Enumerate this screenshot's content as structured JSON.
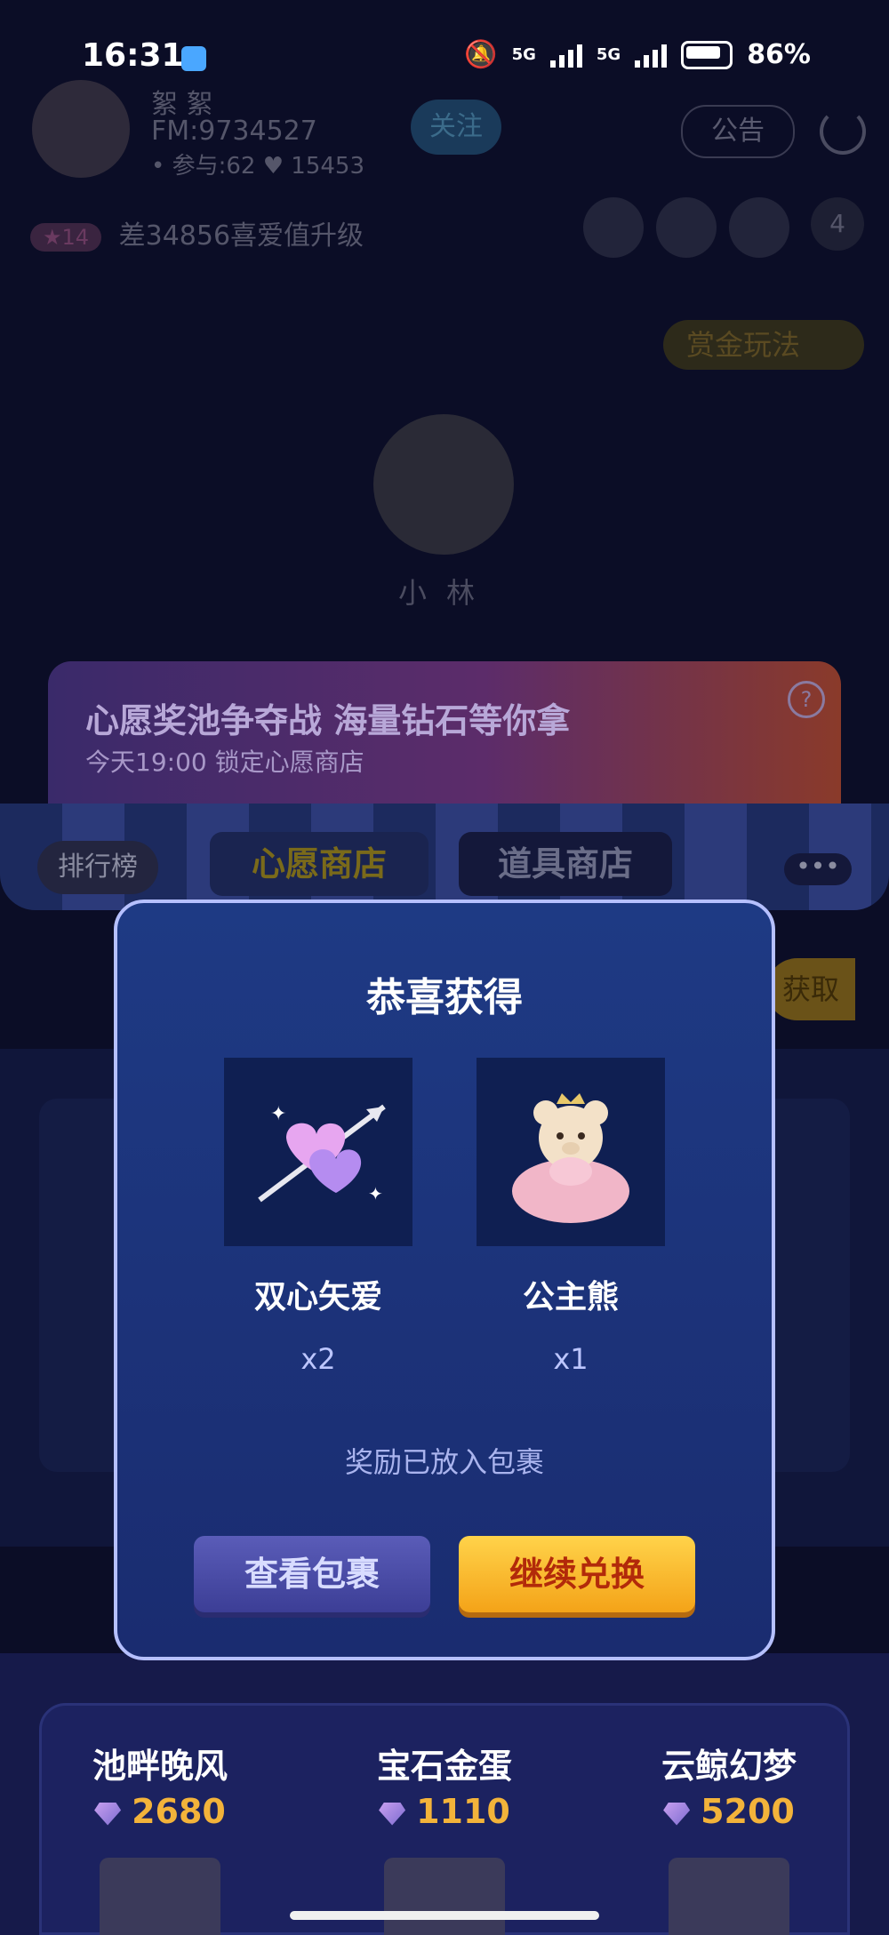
{
  "status_bar": {
    "time": "16:31",
    "network1": "5G",
    "network2": "5G",
    "battery": "86%"
  },
  "room": {
    "host_name": "絮  絮",
    "host_fm": "FM:9734527",
    "host_stats": "• 参与:62   ♥ 15453",
    "follow_label": "关注",
    "notice_label": "公告",
    "level_badge": "★14",
    "level_text": "差34856喜爱值升级",
    "viewer_count": "4",
    "play_label": "赏金玩法",
    "seat_name": "小林"
  },
  "banner": {
    "title": "心愿奖池争夺战 海量钻石等你拿",
    "subtitle": "今天19:00 锁定心愿商店",
    "help": "?"
  },
  "tabs": {
    "rank": "排行榜",
    "wish_shop": "心愿商店",
    "props_shop": "道具商店",
    "more": "•••",
    "get": "获取"
  },
  "bottom_items": [
    {
      "name": "池畔晚风",
      "price": "2680"
    },
    {
      "name": "宝石金蛋",
      "price": "1110"
    },
    {
      "name": "云鲸幻梦",
      "price": "5200"
    }
  ],
  "modal": {
    "title": "恭喜获得",
    "rewards": [
      {
        "name": "双心矢爱",
        "qty": "x2",
        "icon": "double-heart-arrow-icon"
      },
      {
        "name": "公主熊",
        "qty": "x1",
        "icon": "princess-bear-icon"
      }
    ],
    "note": "奖励已放入包裹",
    "btn_view_bag": "查看包裹",
    "btn_continue": "继续兑换"
  },
  "colors": {
    "accent_gold": "#f3b33a",
    "modal_border": "#b6c0ff",
    "modal_bg": "#1e3a84"
  }
}
